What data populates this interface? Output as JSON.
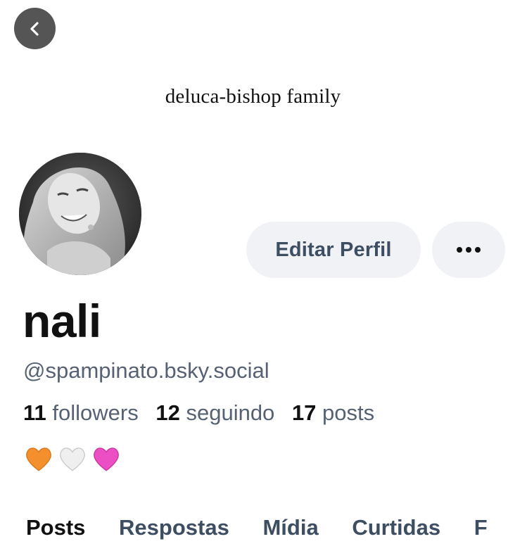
{
  "banner": {
    "title": "deluca-bishop family"
  },
  "header": {
    "back_icon": "chevron-left-icon"
  },
  "profile": {
    "display_name": "nali",
    "handle": "@spampinato.bsky.social",
    "stats": {
      "followers_count": "11",
      "followers_label": "followers",
      "following_count": "12",
      "following_label": "seguindo",
      "posts_count": "17",
      "posts_label": "posts"
    },
    "bio_emojis": [
      "orange-heart",
      "white-heart",
      "pink-heart"
    ]
  },
  "actions": {
    "edit_label": "Editar Perfil",
    "more_icon": "ellipsis-icon"
  },
  "tabs": [
    {
      "label": "Posts",
      "active": true
    },
    {
      "label": "Respostas",
      "active": false
    },
    {
      "label": "Mídia",
      "active": false
    },
    {
      "label": "Curtidas",
      "active": false
    },
    {
      "label": "F",
      "active": false
    }
  ],
  "colors": {
    "text_primary": "#111111",
    "text_secondary": "#566274",
    "button_bg": "#f0f2f5",
    "button_text": "#3d4e63",
    "orange_heart": "#f3902d",
    "white_heart": "#efefef",
    "pink_heart": "#ec4fc4"
  }
}
